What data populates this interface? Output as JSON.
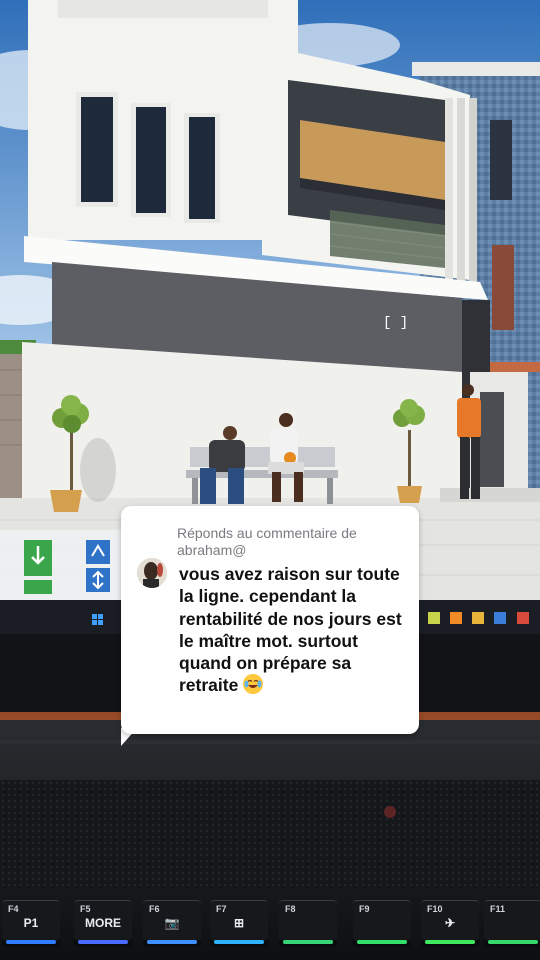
{
  "reply": {
    "header": "Réponds au commentaire de abraham@",
    "comment": "vous avez raison sur toute la ligne. cependant la rentabilité de nos jours est le maître mot. surtout quand on prépare sa retraite",
    "emoji": "face-with-tears-of-joy-icon"
  },
  "keyboard": {
    "keys": [
      {
        "top": "F4",
        "main": "P1",
        "glow": "#2f7cff"
      },
      {
        "top": "F5",
        "main": "MORE",
        "glow": "#4a6bff"
      },
      {
        "top": "F6",
        "main": "📷",
        "glow": "#3e8fff"
      },
      {
        "top": "F7",
        "main": "⊞",
        "glow": "#2fb3ff"
      },
      {
        "top": "F8",
        "main": "",
        "glow": "#37d47a"
      },
      {
        "top": "F9",
        "main": "",
        "glow": "#33e06a"
      },
      {
        "top": "F10",
        "main": "✈",
        "glow": "#40e860"
      },
      {
        "top": "F11",
        "main": "",
        "glow": "#36d86a"
      }
    ]
  },
  "colors": {
    "sky": "#5c93cf",
    "wall": "#f1f1ee",
    "accent_orange": "#ff7a2a",
    "ground": "#e3e3e0"
  }
}
